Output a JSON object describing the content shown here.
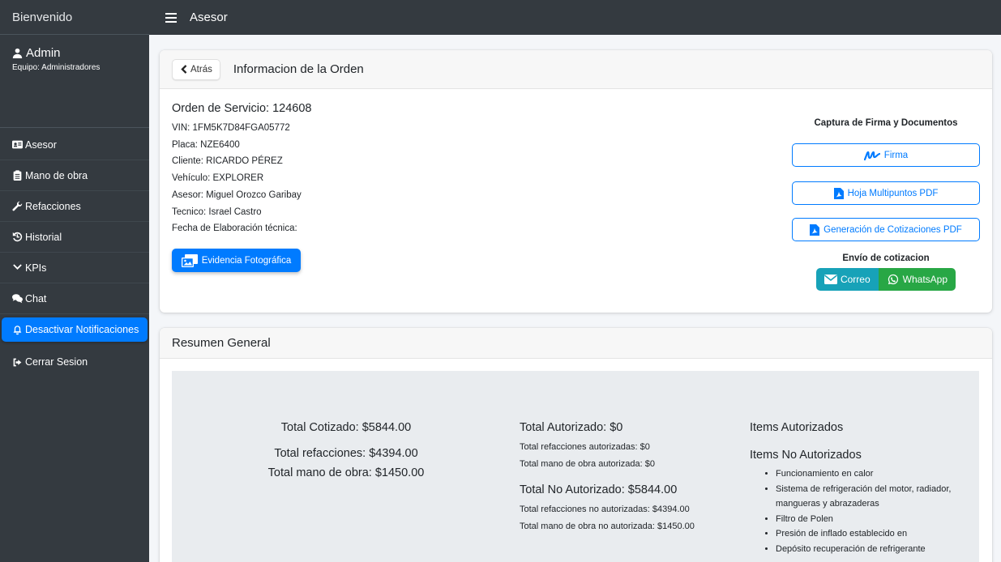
{
  "sidebar": {
    "brand": "Bienvenido",
    "user": {
      "name": "Admin",
      "team": "Equipo: Administradores"
    },
    "items": [
      {
        "label": "Asesor",
        "icon": "id-card-icon"
      },
      {
        "label": "Mano de obra",
        "icon": "clipboard-icon"
      },
      {
        "label": "Refacciones",
        "icon": "wrench-icon"
      },
      {
        "label": "Historial",
        "icon": "history-icon"
      },
      {
        "label": "KPIs",
        "icon": "chevron-down-icon"
      },
      {
        "label": "Chat",
        "icon": "chat-icon"
      },
      {
        "label": "Desactivar Notificaciones",
        "icon": "bell-icon"
      },
      {
        "label": "Cerrar Sesion",
        "icon": "sign-out-icon"
      }
    ]
  },
  "topbar": {
    "title": "Asesor"
  },
  "order_card": {
    "back_label": "Atrás",
    "title": "Informacion de la Orden",
    "order_heading": "Orden de Servicio: 124608",
    "details": {
      "vin": "VIN: 1FM5K7D84FGA05772",
      "placa": "Placa: NZE6400",
      "cliente": "Cliente: RICARDO PÉREZ",
      "vehiculo": "Vehículo: EXPLORER",
      "asesor": "Asesor: Miguel Orozco Garibay",
      "tecnico": "Tecnico: Israel Castro",
      "fecha": "Fecha de Elaboración técnica:"
    },
    "photo_button": "Evidencia Fotográfica",
    "capture_title": "Captura de Firma y Documentos",
    "firma_button": "Firma",
    "multipuntos_button": "Hoja Multipuntos PDF",
    "cotizaciones_button": "Generación de Cotizaciones PDF",
    "envio_title": "Envío de cotizacion",
    "correo_button": "Correo",
    "whatsapp_button": "WhatsApp"
  },
  "summary_card": {
    "title": "Resumen General",
    "total_cotizado": "Total Cotizado: $5844.00",
    "total_refacciones": "Total refacciones: $4394.00",
    "total_mano_obra": "Total mano de obra: $1450.00",
    "total_autorizado": "Total Autorizado: $0",
    "refacciones_autorizadas": "Total refacciones autorizadas: $0",
    "mano_obra_autorizada": "Total mano de obra autorizada: $0",
    "total_no_autorizado": "Total No Autorizado: $5844.00",
    "refacciones_no_autorizadas": "Total refacciones no autorizadas: $4394.00",
    "mano_obra_no_autorizada": "Total mano de obra no autorizada: $1450.00",
    "items_autorizados_title": "Items Autorizados",
    "items_no_autorizados_title": "Items No Autorizados",
    "items_no_autorizados": [
      "Funcionamiento en calor",
      "Sistema de refrigeración del motor, radiador, mangueras y abrazaderas",
      "Filtro de Polen",
      "Presión de inflado establecido en",
      "Depósito recuperación de refrigerante"
    ]
  },
  "colors": {
    "sidebar_bg": "#343a40",
    "primary": "#007bff",
    "info": "#17a2b8",
    "success": "#28a745"
  }
}
